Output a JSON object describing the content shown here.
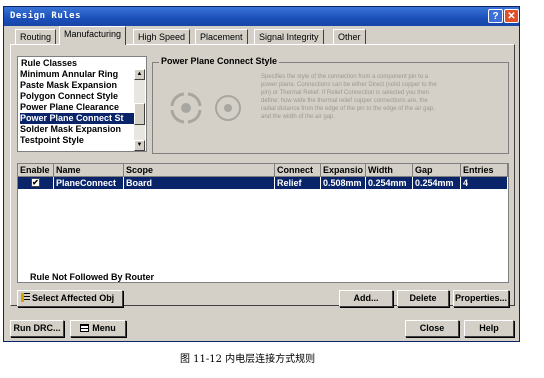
{
  "window": {
    "title": "Design Rules",
    "help_glyph": "?",
    "close_glyph": "✕"
  },
  "tabs": [
    {
      "label": "Routing"
    },
    {
      "label": "Manufacturing"
    },
    {
      "label": "High Speed"
    },
    {
      "label": "Placement"
    },
    {
      "label": "Signal Integrity"
    },
    {
      "label": "Other"
    }
  ],
  "rule_classes": {
    "header": "Rule Classes",
    "items": [
      "Minimum Annular Ring",
      "Paste Mask Expansion",
      "Polygon Connect Style",
      "Power Plane Clearance",
      "Power Plane Connect St",
      "Solder Mask Expansion",
      "Testpoint Style"
    ],
    "selected_index": 4
  },
  "description": {
    "title": "Power Plane Connect Style",
    "text": "Specifies the style of the connection from a component pin to a power plane. Connections can be either Direct (solid copper to the pin) or Thermal Relief. If Relief Connection is selected you then define: how wide the thermal relief copper connections are, the radial distance from the edge of the pin to the edge of the air gap, and the width of the air gap."
  },
  "grid": {
    "columns": [
      "Enable",
      "Name",
      "Scope",
      "Connect",
      "Expansio",
      "Width",
      "Gap",
      "Entries"
    ],
    "rows": [
      {
        "enabled": true,
        "check": "✔",
        "name": "PlaneConnect",
        "scope": "Board",
        "connect": "Relief",
        "expansion": "0.508mm",
        "width": "0.254mm",
        "gap": "0.254mm",
        "entries": "4"
      }
    ],
    "footer": "Rule Not Followed By Router"
  },
  "buttons": {
    "select_affected": "Select Affected Obj",
    "add": "Add...",
    "delete": "Delete",
    "properties": "Properties...",
    "run_drc": "Run DRC...",
    "menu": "Menu",
    "close": "Close",
    "help": "Help"
  },
  "caption": "图 11-12    内电层连接方式规则",
  "colors": {
    "title_bar": "#1a4fb8",
    "selection": "#0a246a",
    "face": "#d4d0c8"
  }
}
